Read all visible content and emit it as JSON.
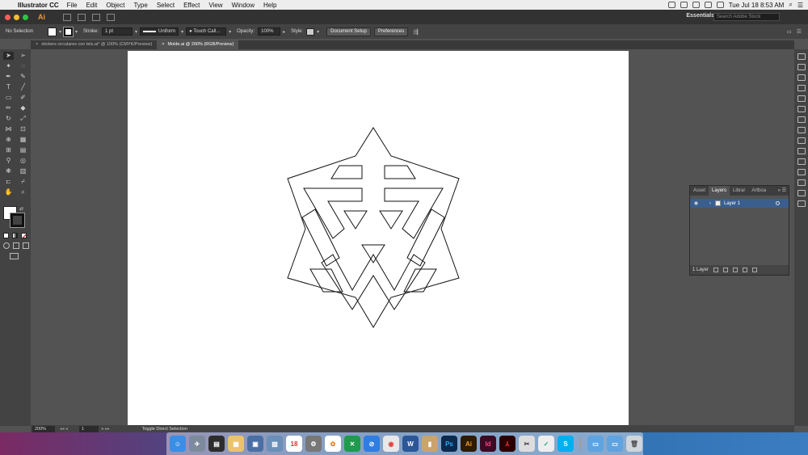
{
  "menubar": {
    "app_name": "Illustrator CC",
    "menus": [
      "File",
      "Edit",
      "Object",
      "Type",
      "Select",
      "Effect",
      "View",
      "Window",
      "Help"
    ],
    "clock": "Tue Jul 18  8:53 AM"
  },
  "appbar": {
    "logo": "Ai",
    "workspace": "Essentials",
    "stock_search_placeholder": "Search Adobe Stock"
  },
  "controlbar": {
    "selection": "No Selection",
    "stroke_label": "Stroke:",
    "stroke_weight": "1 pt",
    "stroke_profile": "Uniform",
    "brush": "Touch Call...",
    "opacity_label": "Opacity:",
    "opacity_value": "100%",
    "style_label": "Style:",
    "document_setup": "Document Setup",
    "preferences": "Preferences"
  },
  "tabs": [
    {
      "label": "stickers circulares con tels.ai* @ 100% (CMYK/Preview)",
      "active": false
    },
    {
      "label": "Molde.ai @ 200% (RGB/Preview)",
      "active": true
    }
  ],
  "layers_panel": {
    "tabs": [
      "Asset",
      "Layers",
      "Librar",
      "Artboa"
    ],
    "active_tab": "Layers",
    "layer_name": "Layer 1",
    "footer_count": "1 Layer"
  },
  "statusbar": {
    "zoom": "200%",
    "page": "1",
    "status": "Toggle Direct Selection"
  },
  "dock": {
    "icons": [
      "finder",
      "launchpad",
      "app-3",
      "app-4",
      "app-5",
      "preview",
      "calendar-18",
      "system-preferences",
      "photos",
      "app-x",
      "safari",
      "chrome",
      "word",
      "app-w",
      "photoshop",
      "illustrator",
      "indesign",
      "acrobat",
      "app-19",
      "app-20",
      "skype",
      "folder",
      "folder-2",
      "trash"
    ],
    "calendar_day": "18",
    "ps": "Ps",
    "ai": "Ai",
    "id": "Id",
    "w": "W",
    "s": "S"
  },
  "colors": {
    "accent": "#f29b24",
    "layer_select": "#3a5f8f",
    "panel": "#535353"
  }
}
